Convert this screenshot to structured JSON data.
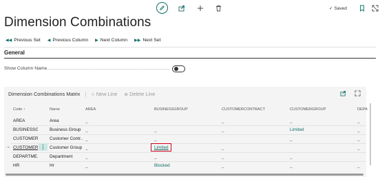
{
  "topbar": {
    "edit_icon": "pencil-icon",
    "share_icon": "share-icon",
    "add_icon": "plus-icon",
    "delete_icon": "trash-icon",
    "saved_label": "Saved",
    "bookmark_icon": "bookmark-icon",
    "popout_icon": "expand-icon",
    "accent": "#0f6c66"
  },
  "page": {
    "title": "Dimension Combinations"
  },
  "actions": [
    {
      "label": "Previous Set",
      "icon": "double-left-arrow"
    },
    {
      "label": "Previous Column",
      "icon": "left-arrow"
    },
    {
      "label": "Next Column",
      "icon": "right-arrow"
    },
    {
      "label": "Next Set",
      "icon": "double-right-arrow"
    }
  ],
  "general": {
    "title": "General",
    "show_column_name_label": "Show Column Name",
    "show_column_name_value": false
  },
  "matrix": {
    "title": "Dimension Combinations Matrix",
    "new_line_label": "New Line",
    "delete_line_label": "Delete Line",
    "columns": {
      "code": "Code ↑",
      "name": "Name",
      "area": "AREA",
      "businessgroup": "BUSINESSGROUP",
      "customercontract": "CUSTOMERCONTRACT",
      "customergroup": "CUSTOMERGROUP",
      "depa": "DEPA"
    },
    "rows": [
      {
        "code": "AREA",
        "name": "Area",
        "area": "_",
        "businessgroup": "",
        "customercontract": "_",
        "customergroup": "_",
        "depa": "_"
      },
      {
        "code": "BUSINESSG...",
        "name": "Business Group",
        "area": "_",
        "businessgroup": "_",
        "customercontract": "_",
        "customergroup": "Limited",
        "depa": "_"
      },
      {
        "code": "CUSTOMER...",
        "name": "Customer Contr...",
        "area": "_",
        "businessgroup": "_",
        "customercontract": "",
        "customergroup": "_",
        "depa": "_"
      },
      {
        "code": "CUSTOMER...",
        "name": "Customer Group",
        "area": "_",
        "businessgroup": "Limited",
        "customercontract": "_",
        "customergroup": "",
        "depa": "_"
      },
      {
        "code": "DEPARTME...",
        "name": "Department",
        "area": "_",
        "businessgroup": "_",
        "customercontract": "_",
        "customergroup": "_",
        "depa": ""
      },
      {
        "code": "HR",
        "name": "Hr",
        "area": "_",
        "businessgroup": "Blocked",
        "customercontract": "_",
        "customergroup": "_",
        "depa": "_"
      }
    ]
  }
}
